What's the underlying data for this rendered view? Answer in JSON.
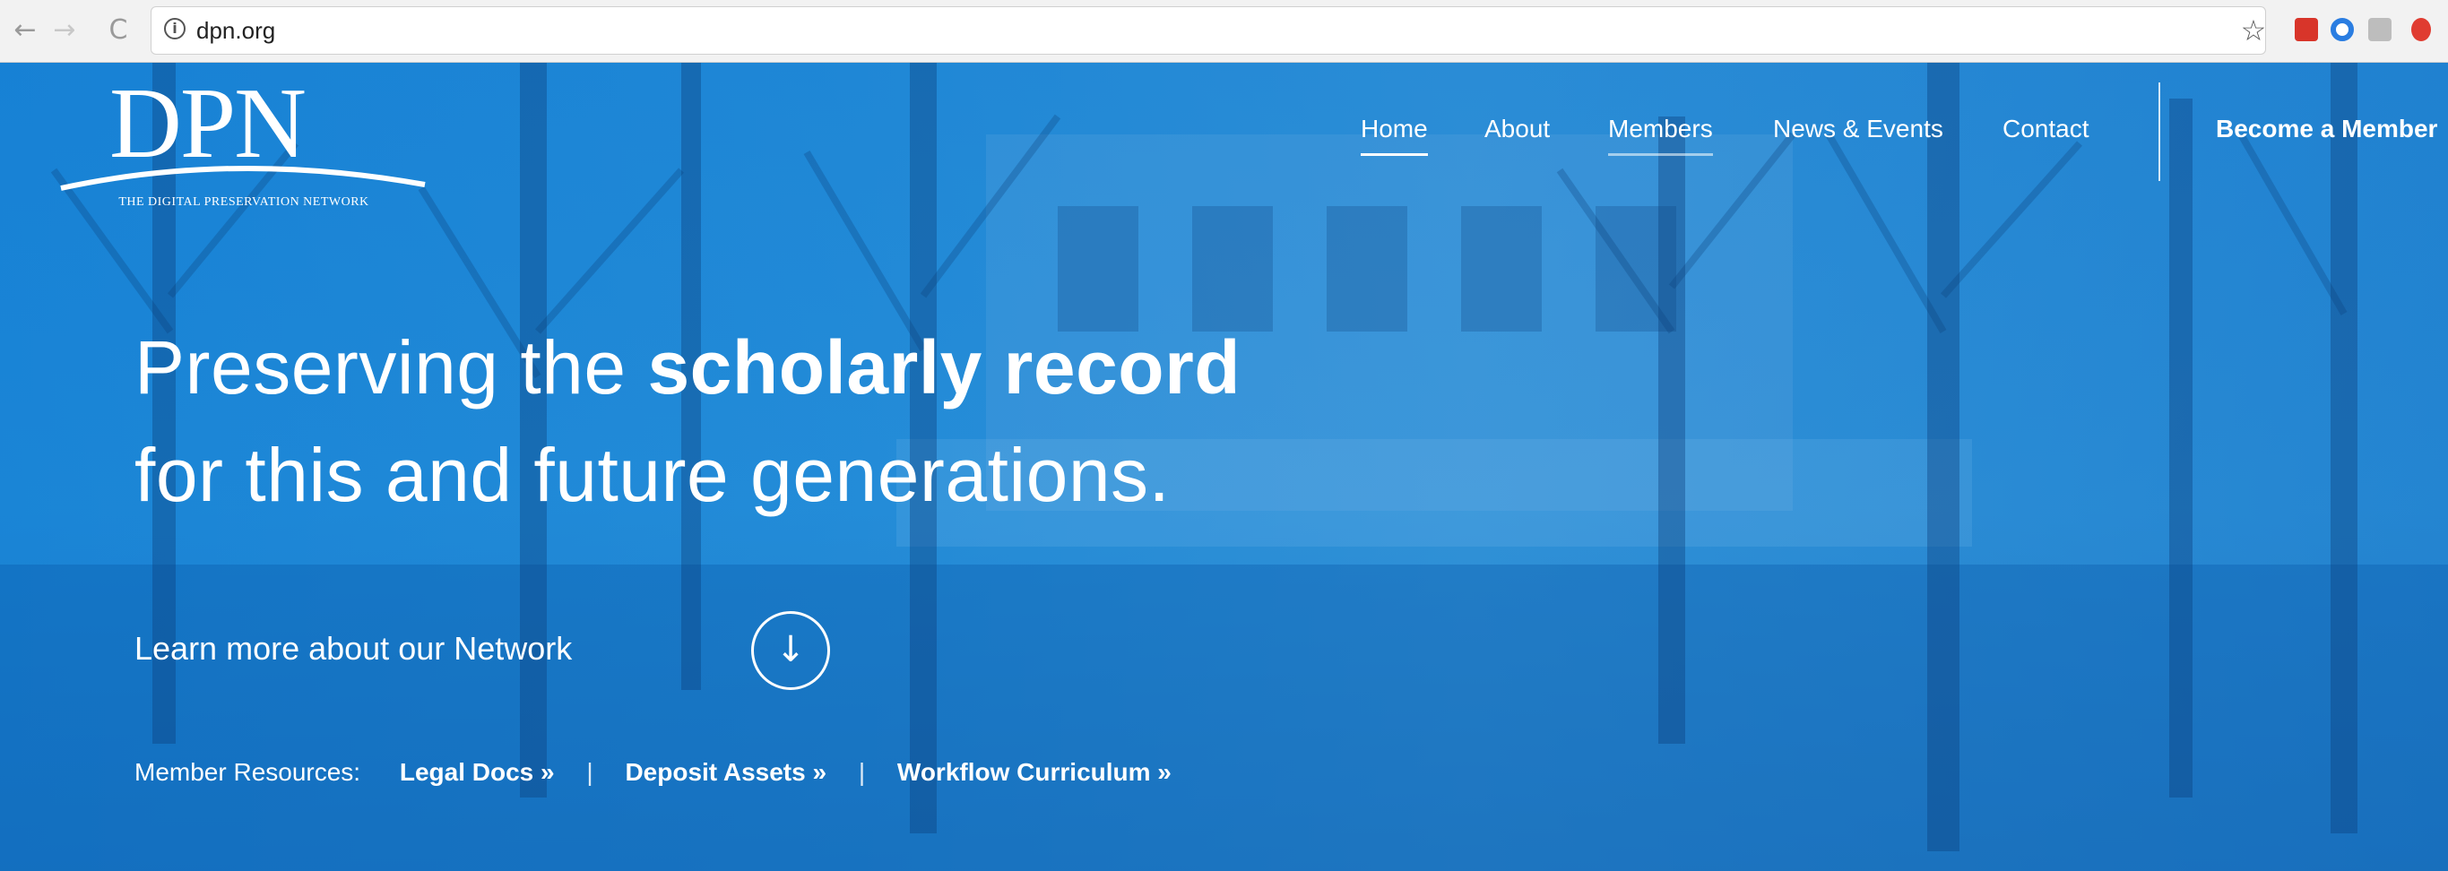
{
  "browser": {
    "back_icon": "←",
    "forward_icon": "→",
    "reload_icon": "C",
    "url": "dpn.org",
    "bookmark_icon": "☆"
  },
  "site": {
    "logo": {
      "mark": "DPN",
      "tagline": "The Digital Preservation Network"
    },
    "nav": {
      "items": [
        "Home",
        "About",
        "Members",
        "News & Events",
        "Contact"
      ],
      "cta": "Become a Member"
    },
    "hero": {
      "headline_line1_a": "Preserving the",
      "headline_line1_b": "scholarly record",
      "headline_line2": "for this and future generations.",
      "learn_more": "Learn more about our Network",
      "learn_more_icon": "↓"
    },
    "resources": {
      "label": "Member Resources:",
      "links": [
        "Legal Docs »",
        "Deposit Assets »",
        "Workflow Curriculum »"
      ],
      "separator": "|"
    }
  },
  "colors": {
    "hero_blue": "#1a7fd0",
    "text": "#ffffff"
  }
}
